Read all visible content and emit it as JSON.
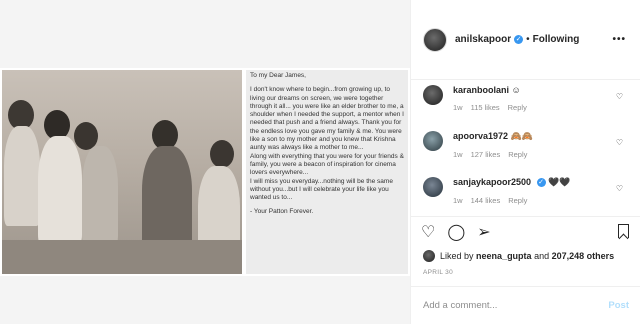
{
  "header": {
    "username": "anilskapoor",
    "following_label": "Following",
    "more_icon": "more-icon"
  },
  "letter": {
    "greeting": "To my Dear James,",
    "body": "I don't know where to begin...from growing up, to living our dreams on screen, we were together through it all... you were like an elder brother to me, a shoulder when I needed the support, a mentor when I needed that push and a friend always. Thank you for the endless love you gave my family & me. You were like a son to my mother and you knew that Krishna aunty was always like a mother to me...\nAlong with everything that you were for your friends & family, you were a beacon of inspiration for cinema lovers everywhere...\nI will miss you everyday...nothing will be the same without you...but I will celebrate your life like you wanted us to...",
    "signoff": "- Your Patton Forever."
  },
  "comments": [
    {
      "username": "karanboolani",
      "text": "☺",
      "age": "1w",
      "likes": "115 likes",
      "reply": "Reply"
    },
    {
      "username": "apoorva1972",
      "text": "🙈🙈",
      "age": "1w",
      "likes": "127 likes",
      "reply": "Reply"
    },
    {
      "username": "sanjaykapoor2500",
      "text": "🖤🖤",
      "age": "1w",
      "likes": "144 likes",
      "reply": "Reply"
    }
  ],
  "likes_line": {
    "prefix": "Liked by",
    "user": "neena_gupta",
    "middle": "and",
    "count": "207,248 others"
  },
  "date": "APRIL 30",
  "add_comment": {
    "placeholder": "Add a comment...",
    "post_label": "Post"
  }
}
